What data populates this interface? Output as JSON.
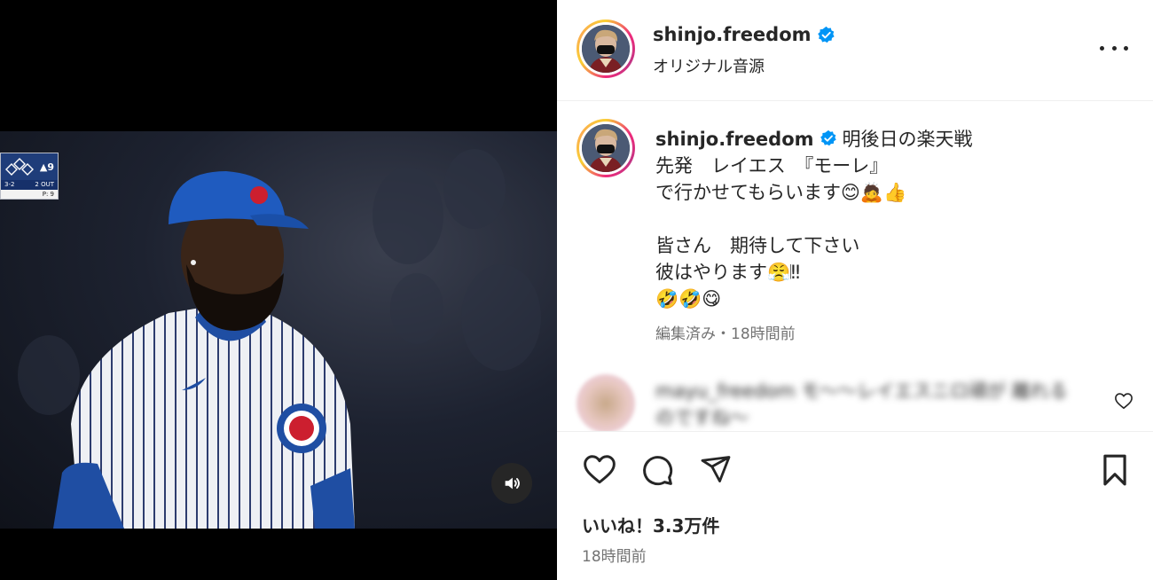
{
  "post": {
    "username": "shinjo.freedom",
    "audio": "オリジナル音源",
    "caption_lines": [
      "明後日の楽天戦",
      "先発　レイエス　『モーレ』",
      "で行かせてもらいます😊🙇👍",
      "",
      "皆さん　期待して下さい",
      "彼はやります😤𝄀‼",
      "🤣🤣😋"
    ],
    "caption_meta": "編集済み・18時間前",
    "likes": "いいね！3.3万件",
    "time": "18時間前"
  },
  "comment": {
    "text": "mayu_freedom モ〜〜レイエスニロ頑が 離れるのですね〜"
  },
  "scorebug": {
    "inning": "9",
    "count": "3-2",
    "outs": "2 OUT",
    "pitches": "P: 9"
  },
  "icons": {
    "verified": "verified-badge-icon",
    "more": "more-options-icon",
    "like": "heart-icon",
    "comment": "comment-bubble-icon",
    "share": "send-icon",
    "save": "bookmark-icon",
    "mute": "speaker-icon"
  },
  "colors": {
    "verified_blue": "#0095f6",
    "text": "#262626",
    "secondary": "#737373",
    "video_bg": "#000000"
  }
}
